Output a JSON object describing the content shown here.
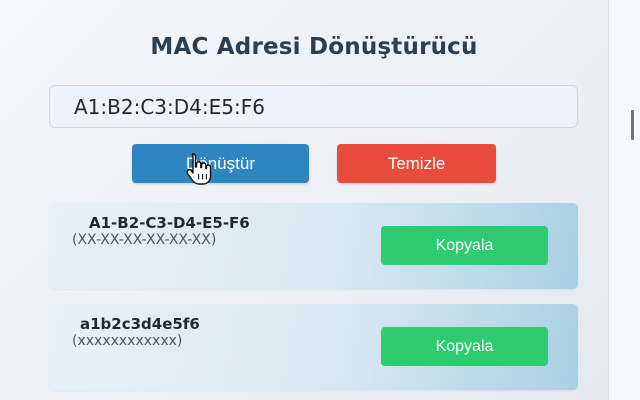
{
  "title": "MAC Adresi Dönüştürücü",
  "input": {
    "value": "A1:B2:C3:D4:E5:F6"
  },
  "buttons": {
    "convert_label": "Dönüştür",
    "clear_label": "Temizle"
  },
  "results": [
    {
      "value": "A1-B2-C3-D4-E5-F6",
      "format": "(XX-XX-XX-XX-XX-XX)",
      "copy_label": "Kopyala"
    },
    {
      "value": "a1b2c3d4e5f6",
      "format": "(xxxxxxxxxxxx)",
      "copy_label": "Kopyala"
    }
  ],
  "colors": {
    "title": "#2c3e50",
    "convert": "#2e86c1",
    "clear": "#e74c3c",
    "copy": "#2ecc71"
  },
  "icons": {
    "cursor": "hand-pointer-icon"
  }
}
